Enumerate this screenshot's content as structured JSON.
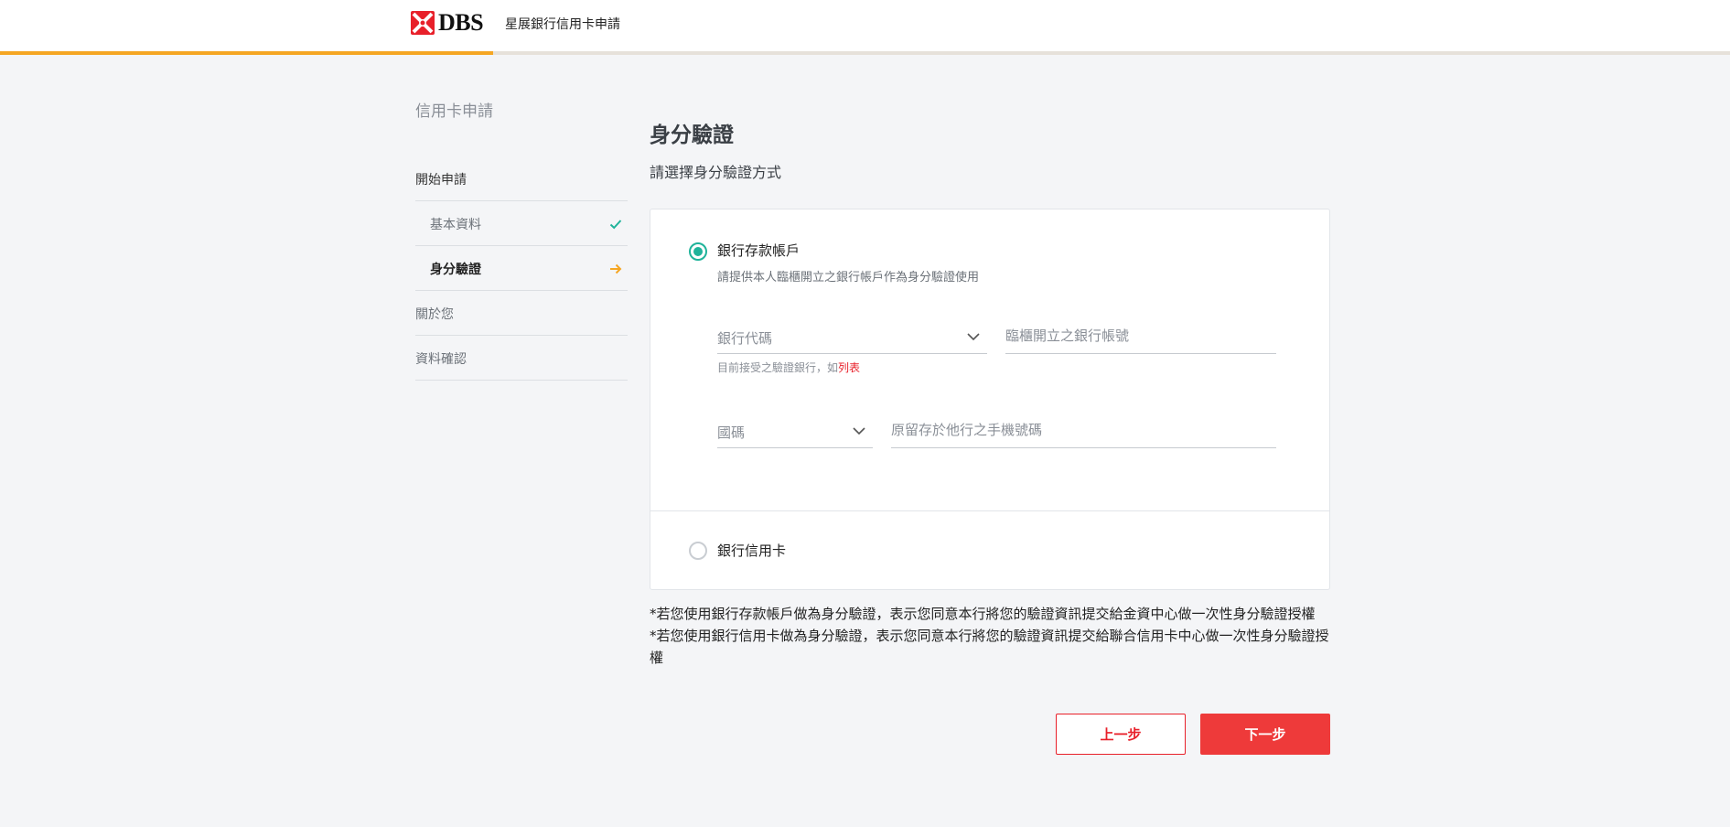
{
  "header": {
    "logo_text": "DBS",
    "title": "星展銀行信用卡申請",
    "progress_percent": 28.5,
    "brand_color": "#e8202a",
    "progress_color": "#f5a623"
  },
  "sidebar": {
    "heading": "信用卡申請",
    "items": [
      {
        "label": "開始申請",
        "status": ""
      },
      {
        "label": "基本資料",
        "status": "done",
        "icon": "check-icon"
      },
      {
        "label": "身分驗證",
        "status": "current",
        "icon": "arrow-right-icon"
      },
      {
        "label": "關於您",
        "status": ""
      },
      {
        "label": "資料確認",
        "status": ""
      }
    ]
  },
  "main": {
    "title": "身分驗證",
    "subtitle": "請選擇身分驗證方式",
    "options": [
      {
        "title": "銀行存款帳戶",
        "description": "請提供本人臨櫃開立之銀行帳戶作為身分驗證使用",
        "selected": true
      },
      {
        "title": "銀行信用卡",
        "selected": false
      }
    ],
    "fields": {
      "bank_code_label": "銀行代碼",
      "account_placeholder": "臨櫃開立之銀行帳號",
      "bank_hint_prefix": "目前接受之驗證銀行，如",
      "bank_hint_link": "列表",
      "country_code_label": "國碼",
      "phone_placeholder": "原留存於他行之手機號碼"
    },
    "notes": [
      "*若您使用銀行存款帳戶做為身分驗證，表示您同意本行將您的驗證資訊提交給金資中心做一次性身分驗證授權",
      "*若您使用銀行信用卡做為身分驗證，表示您同意本行將您的驗證資訊提交給聯合信用卡中心做一次性身分驗證授權"
    ],
    "buttons": {
      "prev_label": "上一步",
      "next_label": "下一步"
    },
    "accent_color": "#1fb39a"
  }
}
